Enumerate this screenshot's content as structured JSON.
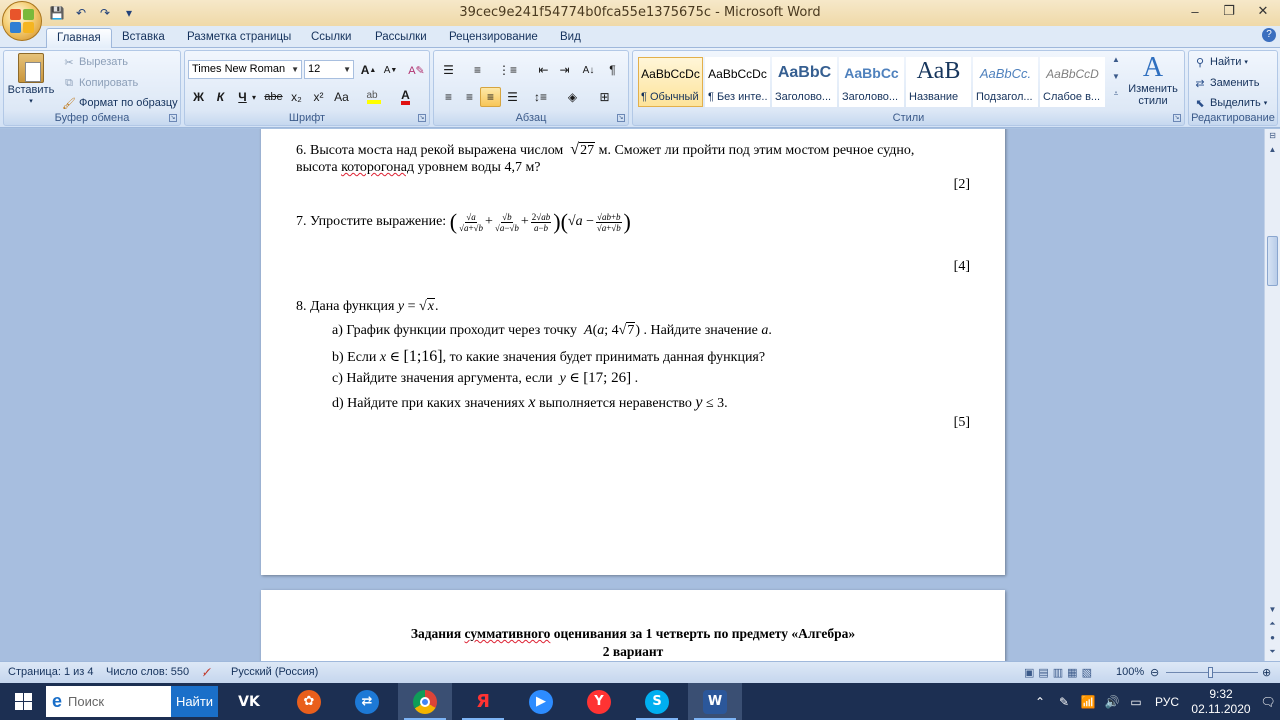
{
  "window": {
    "title": "39cec9e241f54774b0fca55e1375675c - Microsoft Word",
    "minimize": "–",
    "maximize": "❐",
    "close": "✕"
  },
  "qat": {
    "save": "💾",
    "undo": "↶",
    "redo": "↷",
    "more": "▾"
  },
  "tabs": [
    "Главная",
    "Вставка",
    "Разметка страницы",
    "Ссылки",
    "Рассылки",
    "Рецензирование",
    "Вид"
  ],
  "ribbon": {
    "clipboard": {
      "label": "Буфер обмена",
      "paste": "Вставить",
      "cut": "Вырезать",
      "copy": "Копировать",
      "format_painter": "Формат по образцу"
    },
    "font": {
      "label": "Шрифт",
      "family": "Times New Roman",
      "size": "12",
      "bold": "Ж",
      "italic": "К",
      "underline": "Ч",
      "strike": "abe",
      "subscript": "x₂",
      "superscript": "x²",
      "case": "Aa",
      "grow": "A",
      "shrink": "A"
    },
    "paragraph": {
      "label": "Абзац",
      "pilcrow": "¶"
    },
    "styles": {
      "label": "Стили",
      "items": [
        {
          "preview": "AaBbCcDc",
          "name": "¶ Обычный"
        },
        {
          "preview": "AaBbCcDc",
          "name": "¶ Без инте..."
        },
        {
          "preview": "AaBbC",
          "name": "Заголово..."
        },
        {
          "preview": "AaBbCc",
          "name": "Заголово..."
        },
        {
          "preview": "АаВ",
          "name": "Название"
        },
        {
          "preview": "AaBbCc.",
          "name": "Подзагол..."
        },
        {
          "preview": "AaBbCcD",
          "name": "Слабое в..."
        }
      ],
      "change": "Изменить стили"
    },
    "editing": {
      "label": "Редактирование",
      "find": "Найти",
      "replace": "Заменить",
      "select": "Выделить"
    }
  },
  "document": {
    "q6_line1": "6. Высота моста над рекой выражена числом",
    "q6_root": "27",
    "q6_line1_end": "м. Сможет ли пройти под этим мостом речное судно,",
    "q6_line2_a": "высота ",
    "q6_line2_err": "которогонад",
    "q6_line2_b": " уровнем воды 4,7 м?",
    "q6_score": "[2]",
    "q7_prefix": "7. Упростите выражение:",
    "q7_score": "[4]",
    "q8_title": "8. Дана функция",
    "q8_a_pre": "a) График функции проходит через точку",
    "q8_a_post": ". Найдите значение",
    "q8_b_pre": "b) Если",
    "q8_b_interval": "[1;16]",
    "q8_b_post": ", то какие значения будет принимать данная функция?",
    "q8_c_pre": "c) Найдите значения аргумента, если",
    "q8_c_interval": "[17; 26]",
    "q8_d_pre": "d)  Найдите при каких значениях",
    "q8_d_post": "выполняется неравенство",
    "q8_score": "[5]",
    "page2_title_a": "Задания ",
    "page2_title_err": "суммативного",
    "page2_title_b": " оценивания за 1 четверть по предмету «Алгебра»",
    "page2_variant": "2 вариант"
  },
  "status": {
    "page": "Страница: 1 из 4",
    "words": "Число слов: 550",
    "language": "Русский (Россия)",
    "zoom": "100%"
  },
  "taskbar": {
    "search_placeholder": "Поиск",
    "search_button": "Найти",
    "lang": "РУС",
    "time": "9:32",
    "date": "02.11.2020"
  },
  "colors": {
    "ribbon": "#dfeaf7",
    "doc_bg": "#a7bedf",
    "taskbar": "#1c2f52"
  }
}
